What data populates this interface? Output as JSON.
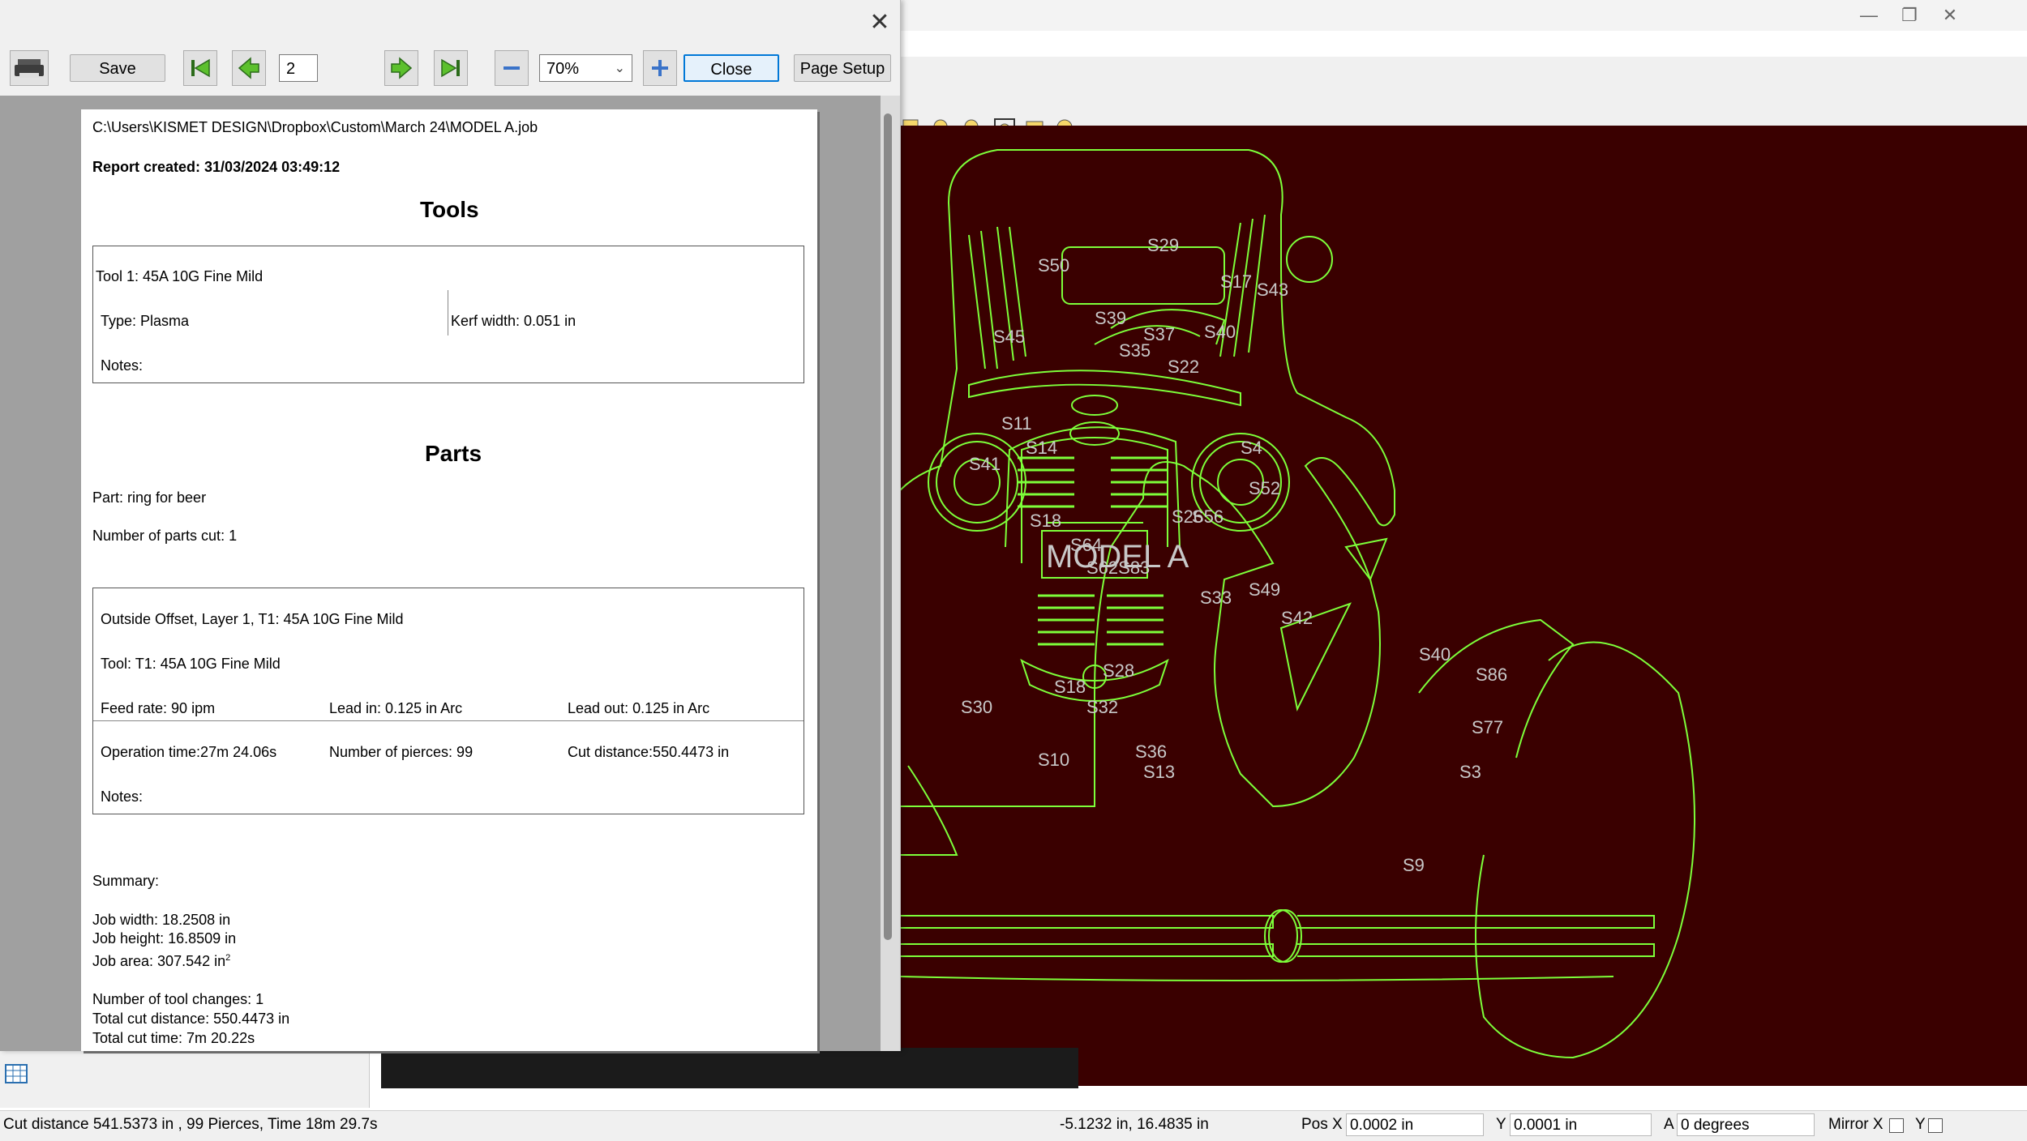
{
  "dialog": {
    "toolbar": {
      "save_label": "Save",
      "page_number": "2",
      "zoom_value": "70%",
      "close_label": "Close",
      "page_setup_label": "Page Setup"
    },
    "report": {
      "file_path": "C:\\Users\\KISMET DESIGN\\Dropbox\\Custom\\March 24\\MODEL A.job",
      "created": "Report created: 31/03/2024 03:49:12",
      "tools_heading": "Tools",
      "tool": {
        "name": "Tool 1: 45A 10G Fine Mild",
        "type": "Type: Plasma",
        "kerf": "Kerf width: 0.051 in",
        "notes": "Notes:"
      },
      "parts_heading": "Parts",
      "part_name": "Part: ring for beer",
      "parts_cut": "Number of parts cut: 1",
      "operation": {
        "title": "Outside Offset, Layer 1, T1: 45A 10G Fine Mild",
        "tool": "Tool: T1: 45A 10G Fine Mild",
        "feed_rate": "Feed rate: 90 ipm",
        "lead_in": "Lead in: 0.125 in Arc",
        "lead_out": "Lead out: 0.125 in Arc",
        "op_time": "Operation time:27m 24.06s",
        "pierces": "Number of pierces: 99",
        "cut_distance": "Cut distance:550.4473 in",
        "notes": "Notes:"
      },
      "summary": {
        "heading": "Summary:",
        "job_width": "Job width: 18.2508 in",
        "job_height": "Job height: 16.8509 in",
        "job_area": "Job area: 307.542 in",
        "job_area_sup": "2",
        "tool_changes": "Number of tool changes: 1",
        "total_cut_distance": "Total cut distance: 550.4473 in",
        "total_cut_time": "Total cut time: 7m 20.22s"
      }
    }
  },
  "canvas": {
    "background": "#3a0000",
    "line_color": "#7dff3a",
    "labels": [
      "S50",
      "S29",
      "S17",
      "S43",
      "S45",
      "S39",
      "S37",
      "S40",
      "S11",
      "S35",
      "S22",
      "S14",
      "S41",
      "S4",
      "S52",
      "S18",
      "S26",
      "S56",
      "S64",
      "S62",
      "S33",
      "S49",
      "S42",
      "S40",
      "S86",
      "S30",
      "S18",
      "S28",
      "S32",
      "S77",
      "S10",
      "S36",
      "S13",
      "S3",
      "S9",
      "MODEL A"
    ],
    "label_color": "#c8c8c8"
  },
  "status": {
    "summary": "Cut distance 541.5373 in , 99 Pierces, Time 18m 29.7s",
    "cursor": "-5.1232 in, 16.4835 in",
    "pos_x_label": "Pos X",
    "pos_x_value": "0.0002 in",
    "y_label": "Y",
    "y_value": "0.0001 in",
    "a_label": "A",
    "a_value": "0 degrees",
    "mirror_x_label": "Mirror X",
    "mirror_y_label": "Y"
  }
}
